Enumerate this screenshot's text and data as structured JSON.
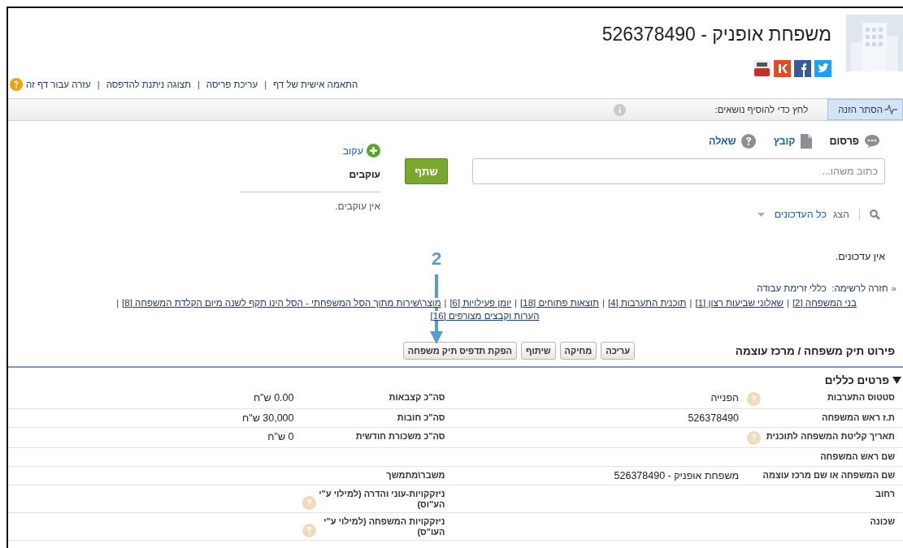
{
  "header": {
    "title": "משפחת אופניק - 526378490"
  },
  "page_links": {
    "separator": "|",
    "items": [
      "התאמה אישית של דף",
      "עריכת פריסה",
      "תצוגה ניתנת להדפסה",
      "עזרה עבור דף זה"
    ]
  },
  "feed_bar": {
    "hide_button": "הסתר הזנה",
    "topics_prompt": "לחץ כדי להוסיף נושאים:"
  },
  "publisher": {
    "tabs": [
      {
        "label": "פרסום",
        "selected": true,
        "kind": "post"
      },
      {
        "label": "קובץ",
        "selected": false,
        "kind": "file"
      },
      {
        "label": "שאלה",
        "selected": false,
        "kind": "question"
      }
    ],
    "placeholder": "כתוב משהו...",
    "share_button": "שתף"
  },
  "followers": {
    "follow_link": "עקוב",
    "title": "עוקבים",
    "empty": "אין עוקבים."
  },
  "feed_filter": {
    "show_label": "הצג",
    "filter": "כל העדכונים"
  },
  "feed_empty": "אין עדכונים.",
  "back_link": {
    "marker": "«",
    "label": "חזרה לרשימה:",
    "target": "כללי זרימת עבודה"
  },
  "related_lists": {
    "separator": "|",
    "items": [
      {
        "label": "בני המשפחה",
        "count": "[2]"
      },
      {
        "label": "שאלוני שביעות רצון",
        "count": "[1]"
      },
      {
        "label": "תוכנית התערבות",
        "count": "[4]"
      },
      {
        "label": "תוצאות פתוחים",
        "count": "[18]"
      },
      {
        "label": "יומן פעילויות",
        "count": "[6]"
      },
      {
        "label": "מוצר\\שירות מתוך הסל המשפחתי - הסל הינו תקף לשנה מיום הקלדת המשפחה",
        "count": "[8]"
      },
      {
        "label": "הערות וקבצים מצורפים",
        "count": "[16]"
      }
    ]
  },
  "detail": {
    "title": "פירוט תיק משפחה / מרכז עוצמה",
    "buttons": [
      "עריכה",
      "מחיקה",
      "שיתוף",
      "הפקת תדפיס תיק משפחה"
    ]
  },
  "section": {
    "title": "פרטים כללים",
    "expanded": true
  },
  "fields": [
    [
      {
        "label": "סטטוס התערבות",
        "value": "הפנייה",
        "help": true
      },
      {
        "label": "סה\"כ קצבאות",
        "value": "0.00 ש\"ח",
        "help": false
      }
    ],
    [
      {
        "label": "ת.ז ראש המשפחה",
        "value": "526378490",
        "help": false
      },
      {
        "label": "סה\"כ חובות",
        "value": "30,000 ש\"ח",
        "help": false
      }
    ],
    [
      {
        "label": "תאריך קליטת המשפחה לתוכנית",
        "help": true
      },
      {
        "label": "סה\"כ משכורת חודשית",
        "value": "0 ש\"ח",
        "help": false
      }
    ],
    [
      {
        "label": "שם ראש המשפחה",
        "help": false
      },
      {
        "help": false
      }
    ],
    [
      {
        "label": "שם המשפחה או שם מרכז עוצמה",
        "value": "משפחת אופניק - 526378490",
        "help": false
      },
      {
        "label": "משבר\\מתמשך",
        "help": false
      }
    ],
    [
      {
        "label": "רחוב",
        "help": false
      },
      {
        "label": "ניזקקויות-עוני והדרה (למילוי ע\"י הע\"וס)",
        "help": true
      }
    ],
    [
      {
        "label": "שכונה",
        "help": false
      },
      {
        "label": "ניזקקויות המשפחה (למילוי ע\"י העו\"ס)",
        "help": true
      }
    ]
  ],
  "annotation": {
    "label": "2"
  }
}
